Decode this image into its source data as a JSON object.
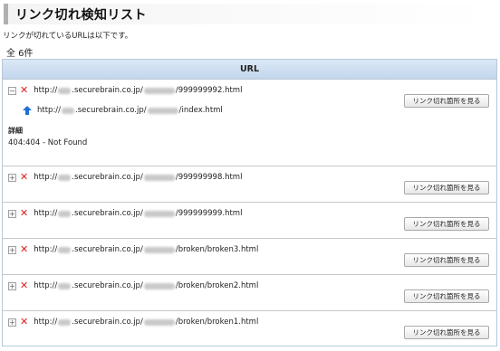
{
  "page": {
    "title": "リンク切れ検知リスト",
    "subtitle": "リンクが切れているURLは以下です。",
    "count_label": "全 6件"
  },
  "table": {
    "header": "URL",
    "button_label": "リンク切れ箇所を見る",
    "detail_label": "詳細",
    "rows": [
      {
        "expanded": true,
        "toggle": "−",
        "url_prefix": "http://",
        "url_domain": ".securebrain.co.jp/",
        "url_path": "/999999992.html",
        "parent_url_prefix": "http://",
        "parent_url_domain": ".securebrain.co.jp/",
        "parent_url_path": "/index.html",
        "detail": "404:404 - Not Found"
      },
      {
        "expanded": false,
        "toggle": "+",
        "url_prefix": "http://",
        "url_domain": ".securebrain.co.jp/",
        "url_path": "/999999998.html"
      },
      {
        "expanded": false,
        "toggle": "+",
        "url_prefix": "http://",
        "url_domain": ".securebrain.co.jp/",
        "url_path": "/999999999.html"
      },
      {
        "expanded": false,
        "toggle": "+",
        "url_prefix": "http://",
        "url_domain": ".securebrain.co.jp/",
        "url_path": "/broken/broken3.html"
      },
      {
        "expanded": false,
        "toggle": "+",
        "url_prefix": "http://",
        "url_domain": ".securebrain.co.jp/",
        "url_path": "/broken/broken2.html"
      },
      {
        "expanded": false,
        "toggle": "+",
        "url_prefix": "http://",
        "url_domain": ".securebrain.co.jp/",
        "url_path": "/broken/broken1.html"
      }
    ]
  },
  "colors": {
    "error_icon": "#dd1f1f",
    "parent_arrow_icon": "#1e6fd9",
    "header_bg": "#c3d6ec"
  }
}
